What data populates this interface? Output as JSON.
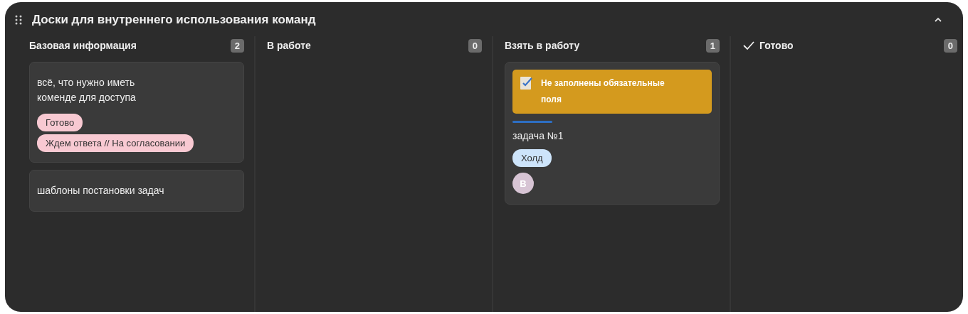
{
  "board": {
    "title": "Доски для внутреннего использования команд",
    "expanded": true
  },
  "columns": [
    {
      "title": "Базовая информация",
      "kind": "plain",
      "count": "2",
      "cards": [
        {
          "title": "всё, что нужно иметь\nкоменде для доступа",
          "tags": [
            {
              "label": "Готово",
              "color": "#f8c9d2"
            },
            {
              "label": "Ждем ответа // На согласовании",
              "color": "#f8c9d2"
            }
          ]
        },
        {
          "title": "шаблоны постановки задач"
        }
      ]
    },
    {
      "title": "В работе",
      "kind": "plain",
      "count": "0"
    },
    {
      "title": "Взять в работу",
      "kind": "plain",
      "count": "1",
      "cards": [
        {
          "warning": "Не заполнены обязательные поля",
          "title": "задача №1",
          "tags": [
            {
              "label": "Холд",
              "color": "#cde4fa"
            }
          ],
          "avatar": "В"
        }
      ]
    },
    {
      "title": "Готово",
      "kind": "done",
      "count": "0"
    }
  ]
}
